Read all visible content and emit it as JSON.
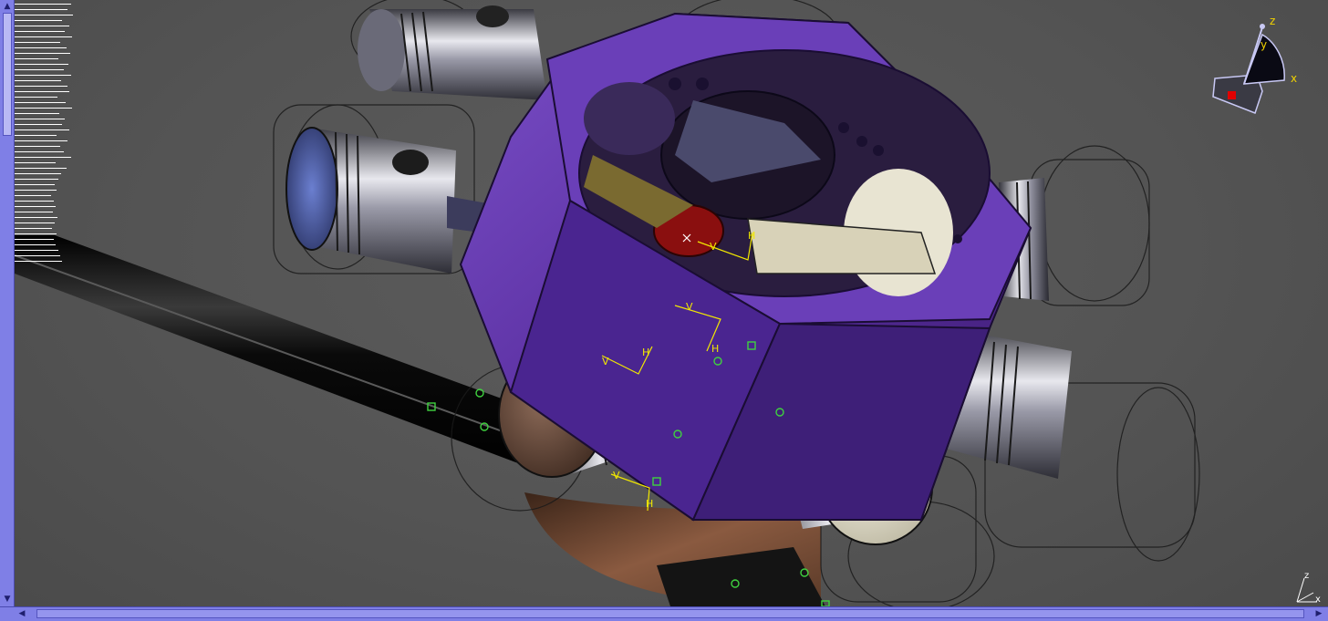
{
  "app": "3D CAD assembly viewer",
  "model": {
    "subject": "radial engine crankcase assembly"
  },
  "compass": {
    "x_label": "x",
    "y_label": "y",
    "z_label": "z"
  },
  "mini_axis": {
    "x_label": "x",
    "z_label": "z"
  },
  "constraint_labels": {
    "vertical": "V",
    "horizontal": "H"
  },
  "colors": {
    "background": "#545454",
    "crankcase": "#5a2fa0",
    "scrollbar": "#7f7fe6",
    "constraint": "#f2e800",
    "anchor_point": "#3fd23f",
    "crank_disc": "#8a0f0f"
  },
  "icons": {
    "scroll_up": "▲",
    "scroll_down": "▼",
    "scroll_left": "◀",
    "scroll_right": "▶"
  }
}
